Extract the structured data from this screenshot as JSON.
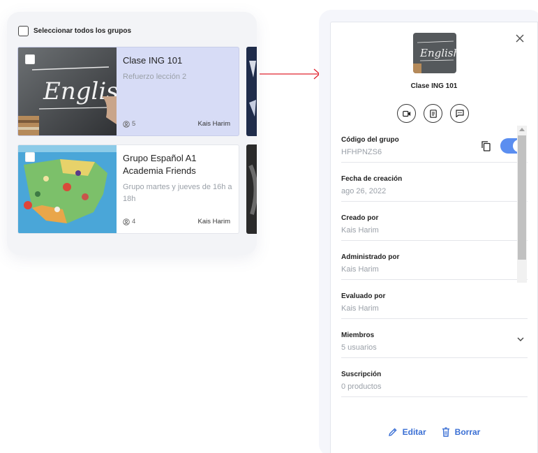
{
  "colors": {
    "accent": "#3a6fd4",
    "toggle": "#5b8ef0",
    "selected_card": "#d7dcf6",
    "arrow": "#e0232e"
  },
  "groups_list": {
    "select_all_label": "Seleccionar todos los grupos",
    "cards": [
      {
        "title": "Clase ING 101",
        "subtitle": "Refuerzo lección 2",
        "members": "5",
        "owner": "Kais Harim",
        "selected": true
      },
      {
        "title": "Grupo Español A1 Academia Friends",
        "subtitle": "Grupo martes y jueves de 16h a 18h",
        "members": "4",
        "owner": "Kais Harim",
        "selected": false
      }
    ]
  },
  "detail": {
    "group_name": "Clase ING 101",
    "thumbnail_text": "English",
    "card_image_text": "English",
    "action_icons": [
      "video-icon",
      "assignment-icon",
      "chat-icon"
    ],
    "rows": [
      {
        "label": "Código del grupo",
        "value": "HFHPNZS6"
      },
      {
        "label": "Fecha de creación",
        "value": "ago 26, 2022"
      },
      {
        "label": "Creado por",
        "value": "Kais Harim"
      },
      {
        "label": "Administrado por",
        "value": "Kais Harim"
      },
      {
        "label": "Evaluado por",
        "value": "Kais Harim"
      },
      {
        "label": "Miembros",
        "value": "5 usuarios"
      },
      {
        "label": "Suscripción",
        "value": "0 productos"
      }
    ],
    "code_toggle_on": true,
    "edit_label": "Editar",
    "delete_label": "Borrar"
  }
}
